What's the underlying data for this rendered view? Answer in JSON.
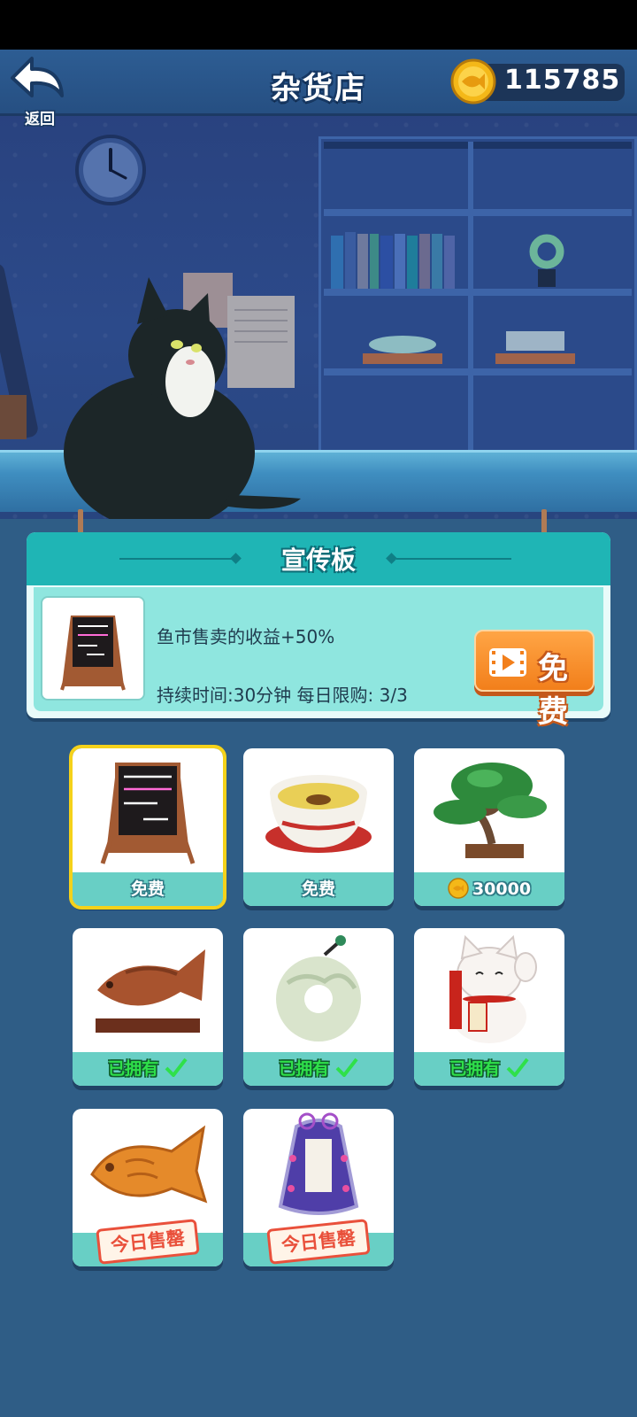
{
  "header": {
    "back_label": "返回",
    "title": "杂货店",
    "coins": "115785"
  },
  "promo": {
    "title": "宣传板",
    "effect": "鱼市售卖的收益+50%",
    "duration": "持续时间:30分钟  每日限购:  3/3",
    "button_label": "免费"
  },
  "items": [
    {
      "name": "宣传板",
      "price_label": "免费",
      "selected": true
    },
    {
      "name": "茶",
      "price_label": "免费"
    },
    {
      "name": "盆栽",
      "price_label": "30000"
    },
    {
      "name": "木鱼雕",
      "status_label": "已拥有"
    },
    {
      "name": "玉佩",
      "status_label": "已拥有"
    },
    {
      "name": "招财猫",
      "status_label": "已拥有"
    },
    {
      "name": "鲷鱼烧",
      "status_label": "今日售罄"
    },
    {
      "name": "幸运御守",
      "status_label": "今日售罄"
    }
  ],
  "colors": {
    "accent_teal": "#1fb5b5",
    "free_button": "#f27f1b",
    "owned_green": "#2fe04a",
    "soldout_red": "#e9503b",
    "selected_border": "#f5d21a"
  }
}
